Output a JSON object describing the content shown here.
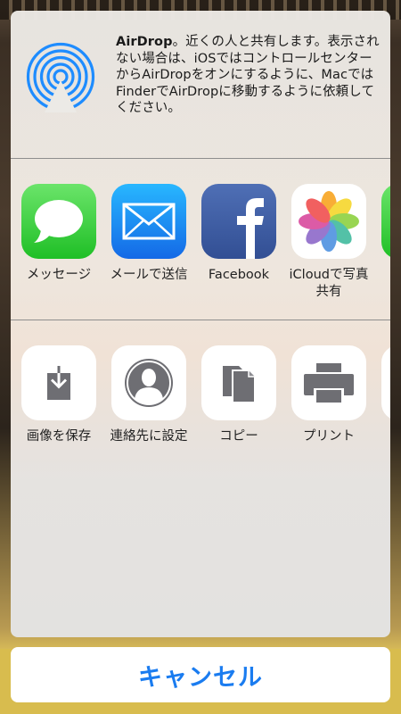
{
  "airdrop": {
    "title": "AirDrop",
    "description": "。近くの人と共有します。表示されない場合は、iOSではコントロールセンターからAirDropをオンにするように、MacではFinderでAirDropに移動するように依頼してください。"
  },
  "share_apps": [
    {
      "label": "メッセージ",
      "icon": "messages-icon"
    },
    {
      "label": "メールで送信",
      "icon": "mail-icon"
    },
    {
      "label": "Facebook",
      "icon": "facebook-icon"
    },
    {
      "label": "iCloudで写真共有",
      "icon": "photos-icon"
    }
  ],
  "actions": [
    {
      "label": "画像を保存",
      "icon": "save-image-icon"
    },
    {
      "label": "連絡先に設定",
      "icon": "contact-icon"
    },
    {
      "label": "コピー",
      "icon": "copy-icon"
    },
    {
      "label": "プリント",
      "icon": "print-icon"
    }
  ],
  "cancel_label": "キャンセル",
  "colors": {
    "accent": "#1a7cf0",
    "airdrop_blue": "#1e8cff",
    "icon_gray": "#6e6e73"
  }
}
